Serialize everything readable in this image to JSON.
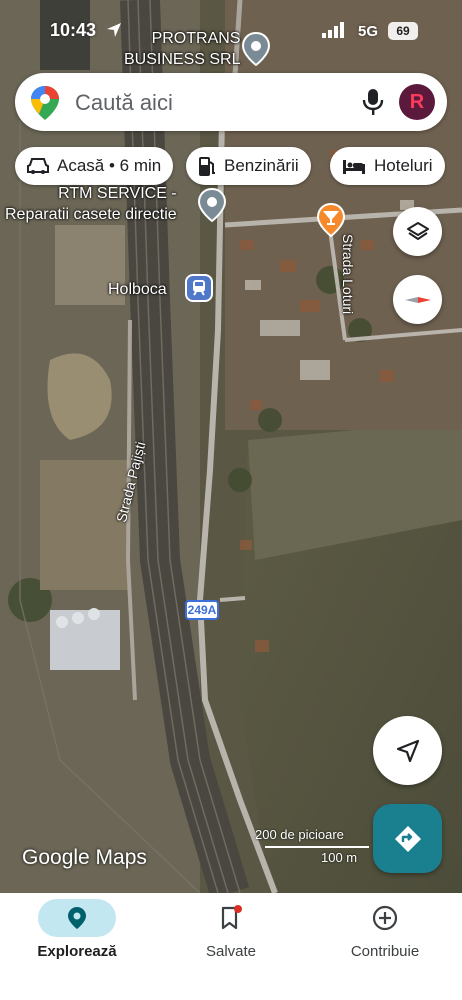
{
  "status_bar": {
    "time": "10:43",
    "network": "5G",
    "battery": "69"
  },
  "search": {
    "placeholder": "Caută aici",
    "avatar_letter": "R"
  },
  "chips": [
    {
      "label": "Acasă • 6 min",
      "icon": "car-icon"
    },
    {
      "label": "Benzinării",
      "icon": "gas-station-icon"
    },
    {
      "label": "Hoteluri",
      "icon": "bed-icon"
    }
  ],
  "places": [
    {
      "name": "PROTRANS\nBUSINESS SRL",
      "icon": "place-pin-icon"
    },
    {
      "name": "RTM SERVICE -\nReparatii casete directie",
      "icon": "place-pin-icon"
    },
    {
      "name": "Holboca",
      "icon": "train-station-icon"
    }
  ],
  "streets": [
    "Strada Loturi",
    "Strada Pajiști"
  ],
  "road_number": "249A",
  "scale": {
    "feet": "200 de picioare",
    "meters": "100 m"
  },
  "branding": "Google Maps",
  "bottom_nav": [
    {
      "label": "Explorează",
      "icon": "explore-pin-icon",
      "active": true
    },
    {
      "label": "Salvate",
      "icon": "bookmark-icon",
      "active": false
    },
    {
      "label": "Contribuie",
      "icon": "add-circle-icon",
      "active": false
    }
  ],
  "colors": {
    "directions_button": "#1a7f8e",
    "active_tab": "#c2e7f0",
    "road_badge": "#3c6fd8"
  }
}
